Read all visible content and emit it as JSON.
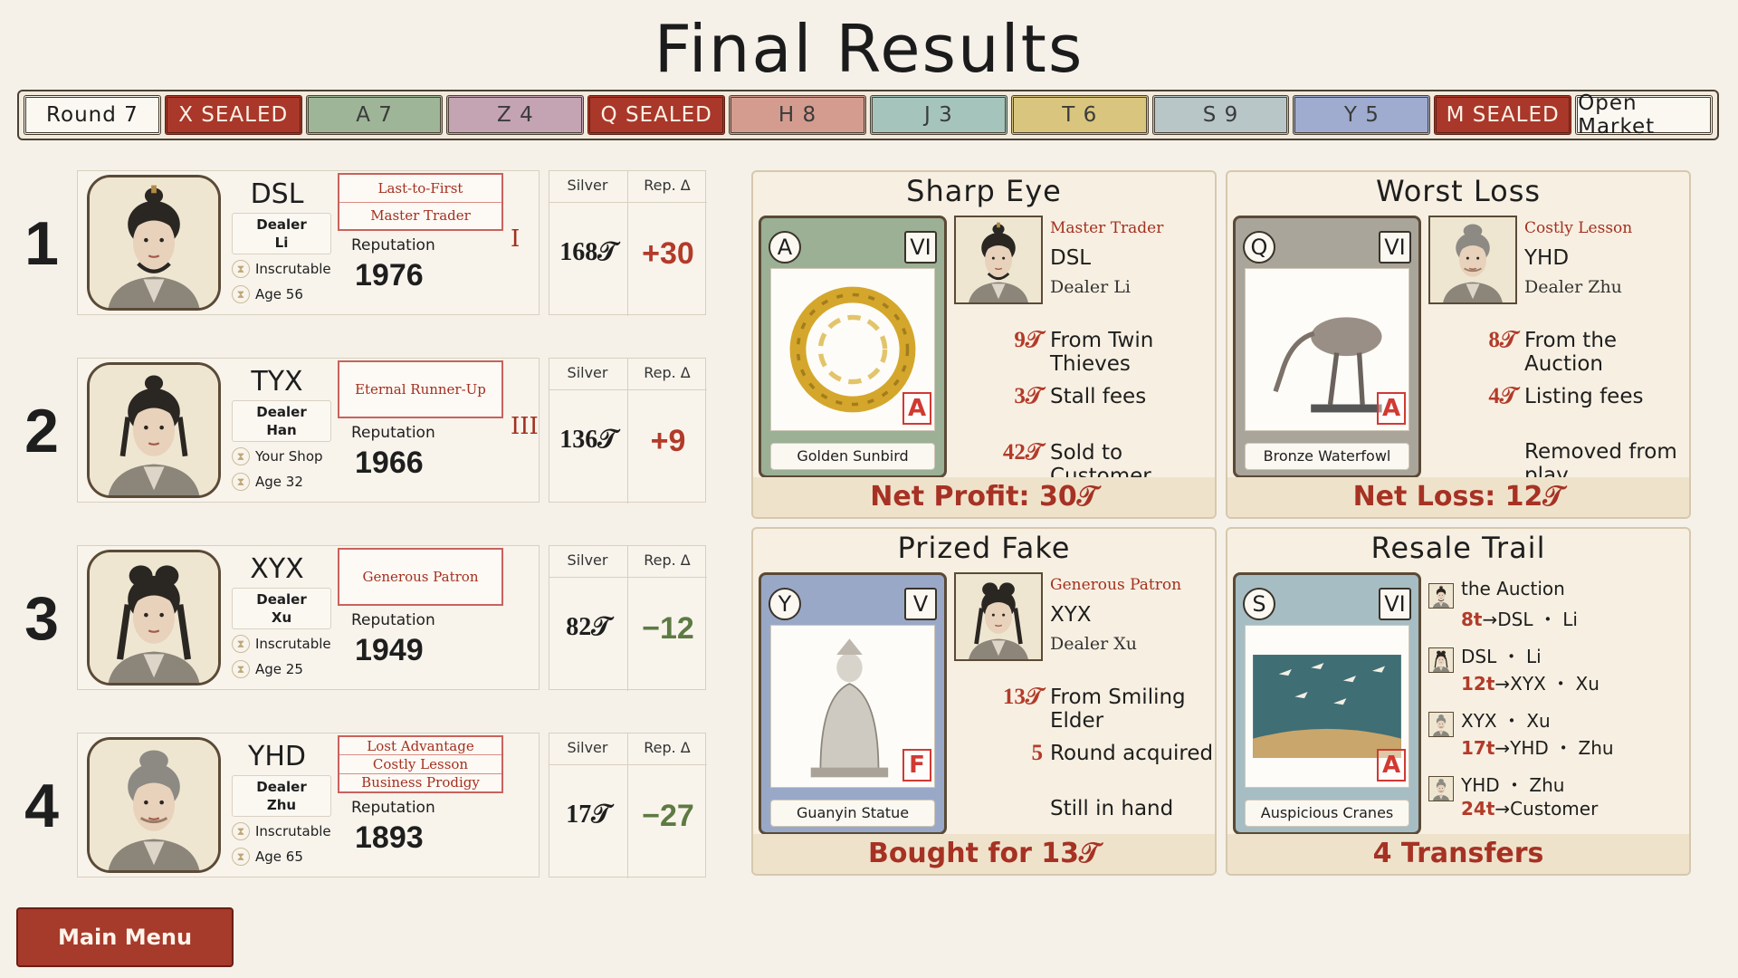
{
  "page_title": "Final Results",
  "round_bar": [
    {
      "label": "Round 7",
      "color": "#fbf8f1",
      "style": "light"
    },
    {
      "label": "X SEALED",
      "color": "#a9382a",
      "style": "sealed"
    },
    {
      "label": "A 7",
      "color": "#9eb598",
      "style": "tile"
    },
    {
      "label": "Z 4",
      "color": "#c4a3b2",
      "style": "tile"
    },
    {
      "label": "Q SEALED",
      "color": "#a9382a",
      "style": "sealed"
    },
    {
      "label": "H 8",
      "color": "#d49c8f",
      "style": "tile"
    },
    {
      "label": "J 3",
      "color": "#a5c5bc",
      "style": "tile"
    },
    {
      "label": "T 6",
      "color": "#d9c57e",
      "style": "tile"
    },
    {
      "label": "S 9",
      "color": "#b8c6c8",
      "style": "tile"
    },
    {
      "label": "Y 5",
      "color": "#9facd0",
      "style": "tile"
    },
    {
      "label": "M SEALED",
      "color": "#a9382a",
      "style": "sealed"
    },
    {
      "label": "Open Market",
      "color": "#fbf8f1",
      "style": "light"
    }
  ],
  "standings": [
    {
      "rank": "1",
      "name": "DSL",
      "dealer": "Dealer",
      "surname": "Li",
      "trait1": "Inscrutable",
      "trait2": "Age 56",
      "titles": [
        "Last-to-First",
        "Master Trader"
      ],
      "rep_label": "Reputation",
      "reputation": "1976",
      "roman": "I",
      "silver_head": "Silver",
      "rep_head": "Rep. Δ",
      "silver": "168𝒯",
      "rep_delta": "+30",
      "delta_sign": "pos",
      "portrait": "man-topknot"
    },
    {
      "rank": "2",
      "name": "TYX",
      "dealer": "Dealer",
      "surname": "Han",
      "trait1": "Your Shop",
      "trait2": "Age 32",
      "titles": [
        "Eternal Runner-Up"
      ],
      "rep_label": "Reputation",
      "reputation": "1966",
      "roman": "III",
      "silver_head": "Silver",
      "rep_head": "Rep. Δ",
      "silver": "136𝒯",
      "rep_delta": "+9",
      "delta_sign": "pos",
      "portrait": "young-man"
    },
    {
      "rank": "3",
      "name": "XYX",
      "dealer": "Dealer",
      "surname": "Xu",
      "trait1": "Inscrutable",
      "trait2": "Age 25",
      "titles": [
        "Generous Patron"
      ],
      "rep_label": "Reputation",
      "reputation": "1949",
      "roman": "",
      "silver_head": "Silver",
      "rep_head": "Rep. Δ",
      "silver": "82𝒯",
      "rep_delta": "−12",
      "delta_sign": "neg",
      "portrait": "young-woman"
    },
    {
      "rank": "4",
      "name": "YHD",
      "dealer": "Dealer",
      "surname": "Zhu",
      "trait1": "Inscrutable",
      "trait2": "Age 65",
      "titles": [
        "Lost Advantage",
        "Costly Lesson",
        "Business Prodigy"
      ],
      "rep_label": "Reputation",
      "reputation": "1893",
      "roman": "",
      "silver_head": "Silver",
      "rep_head": "Rep. Δ",
      "silver": "17𝒯",
      "rep_delta": "−27",
      "delta_sign": "neg",
      "portrait": "old-woman"
    }
  ],
  "panels": {
    "sharp_eye": {
      "title": "Sharp Eye",
      "card": {
        "letter": "A",
        "roman": "VI",
        "name": "Golden Sunbird",
        "stamp": "A",
        "color": "green",
        "art": "golden-ring"
      },
      "player_title": "Master Trader",
      "player_name": "DSL",
      "player_dealer": "Dealer Li",
      "lines": [
        {
          "amount": "9𝒯",
          "text": "From Twin Thieves"
        },
        {
          "amount": "3𝒯",
          "text": "Stall fees"
        },
        {
          "amount": "42𝒯",
          "text": "Sold to Customer"
        }
      ],
      "footer": "Net Profit: 30𝒯"
    },
    "worst_loss": {
      "title": "Worst Loss",
      "card": {
        "letter": "Q",
        "roman": "VI",
        "name": "Bronze Waterfowl",
        "stamp": "A",
        "color": "grey",
        "art": "crane"
      },
      "player_title": "Costly Lesson",
      "player_name": "YHD",
      "player_dealer": "Dealer Zhu",
      "lines": [
        {
          "amount": "8𝒯",
          "text": "From the Auction"
        },
        {
          "amount": "4𝒯",
          "text": "Listing fees"
        },
        {
          "amount": "",
          "text": "Removed from play"
        }
      ],
      "footer": "Net Loss: 12𝒯"
    },
    "prized_fake": {
      "title": "Prized Fake",
      "card": {
        "letter": "Y",
        "roman": "V",
        "name": "Guanyin Statue",
        "stamp": "F",
        "color": "blue",
        "art": "statue"
      },
      "player_title": "Generous Patron",
      "player_name": "XYX",
      "player_dealer": "Dealer Xu",
      "lines": [
        {
          "amount": "13𝒯",
          "text": "From Smiling Elder"
        },
        {
          "amount": "5",
          "text": "Round acquired"
        },
        {
          "amount": "",
          "text": "Still in hand"
        }
      ],
      "footer": "Bought for 13𝒯"
    },
    "resale_trail": {
      "title": "Resale Trail",
      "card": {
        "letter": "S",
        "roman": "VI",
        "name": "Auspicious Cranes",
        "stamp": "A",
        "color": "teal",
        "art": "cranes-painting"
      },
      "transfers": [
        {
          "from": "the Auction",
          "amount": "8t",
          "to": "DSL ・ Li"
        },
        {
          "from": "DSL ・ Li",
          "amount": "12t",
          "to": "XYX ・ Xu"
        },
        {
          "from": "XYX ・ Xu",
          "amount": "17t",
          "to": "YHD ・ Zhu"
        },
        {
          "from": "YHD ・ Zhu",
          "amount": "24t",
          "to": "Customer"
        }
      ],
      "arrow": "→",
      "footer": "4 Transfers"
    }
  },
  "main_menu": "Main Menu",
  "colors": {
    "accent_red": "#a63a2b",
    "positive": "#b23b2a",
    "negative": "#5e7a43",
    "background": "#f5f1e9"
  }
}
